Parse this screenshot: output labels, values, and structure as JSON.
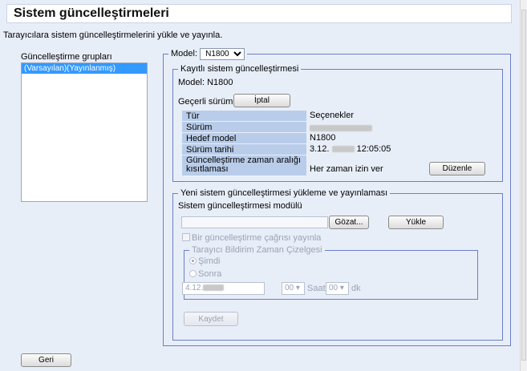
{
  "page": {
    "title": "Sistem güncelleştirmeleri",
    "description": "Tarayıcılara sistem güncelleştirmelerini yükle ve yayınla."
  },
  "groups": {
    "label": "Güncelleştirme grupları",
    "items": [
      "(Varsayılan)(Yayınlanmış)"
    ]
  },
  "model": {
    "label": "Model:",
    "selected": "N1800"
  },
  "registered": {
    "legend": "Kayıtlı sistem güncelleştirmesi",
    "model_line": "Model: N1800",
    "current_version_label": "Geçerli sürüm",
    "cancel_button": "İptal",
    "rows": [
      {
        "label": "Tür",
        "value": "Seçenekler"
      },
      {
        "label": "Sürüm",
        "value": ""
      },
      {
        "label": "Hedef model",
        "value": "N1800"
      },
      {
        "label": "Sürüm tarihi",
        "value_prefix": "3.12.",
        "value_suffix": "12:05:05"
      },
      {
        "label": "Güncelleştirme zaman aralığı kısıtlaması",
        "value": "Her zaman izin ver"
      }
    ],
    "edit_button": "Düzenle"
  },
  "new_update": {
    "legend": "Yeni sistem güncelleştirmesi yükleme ve yayınlaması",
    "module_label": "Sistem güncelleştirmesi modülü",
    "file_path": "",
    "browse_button": "Gözat...",
    "upload_button": "Yükle",
    "publish_checkbox": "Bir güncelleştirme çağrısı yayınla",
    "schedule": {
      "legend": "Tarayıcı Bildirim Zaman Çizelgesi",
      "now": "Şimdi",
      "later": "Sonra",
      "date_prefix": "4.12.",
      "hour": "00",
      "hour_unit": "Saat",
      "minute": "00",
      "minute_unit": "dk"
    },
    "save_button": "Kaydet"
  },
  "back_button": "Geri"
}
